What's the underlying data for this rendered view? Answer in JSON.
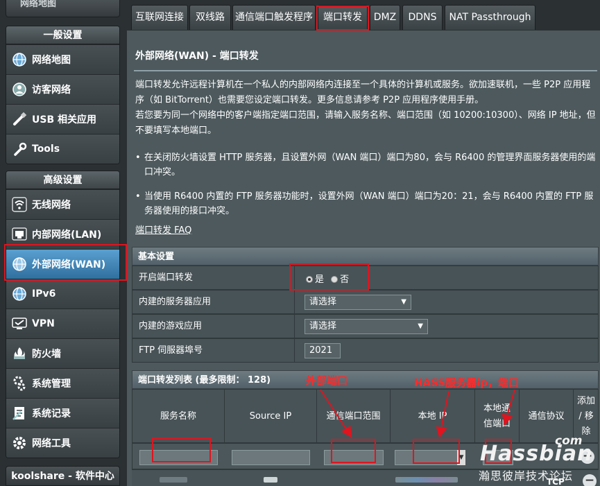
{
  "sidebar": {
    "top_fragment": "网络地图",
    "general": {
      "header": "一般设置",
      "items": [
        {
          "label": "网络地图",
          "icon": "globe-icon"
        },
        {
          "label": "访客网络",
          "icon": "guest-network-icon"
        },
        {
          "label": "USB 相关应用",
          "icon": "usb-icon"
        },
        {
          "label": "Tools",
          "icon": "wrench-icon"
        }
      ]
    },
    "advanced": {
      "header": "高级设置",
      "items": [
        {
          "label": "无线网络",
          "icon": "wifi-icon"
        },
        {
          "label": "内部网络(LAN)",
          "icon": "lan-icon"
        },
        {
          "label": "外部网络(WAN)",
          "icon": "wan-globe-icon",
          "active": true
        },
        {
          "label": "IPv6",
          "icon": "ipv6-globe-icon"
        },
        {
          "label": "VPN",
          "icon": "vpn-icon"
        },
        {
          "label": "防火墙",
          "icon": "firewall-icon"
        },
        {
          "label": "系统管理",
          "icon": "gear-icon"
        },
        {
          "label": "系统记录",
          "icon": "log-icon"
        },
        {
          "label": "网络工具",
          "icon": "tools-gear-icon"
        }
      ]
    },
    "bottom": "koolshare - 软件中心"
  },
  "tabs": [
    {
      "label": "互联网连接"
    },
    {
      "label": "双线路"
    },
    {
      "label": "通信端口触发程序"
    },
    {
      "label": "端口转发",
      "active": true
    },
    {
      "label": "DMZ"
    },
    {
      "label": "DDNS"
    },
    {
      "label": "NAT Passthrough"
    }
  ],
  "main": {
    "title": "外部网络(WAN) - 端口转发",
    "desc1": "端口转发允许远程计算机在一个私人的内部网络内连接至一个具体的计算机或服务。欲加速联机，一些 P2P 应用程序（如 BitTorrent）也需要您设定端口转发。更多信息请参考 P2P 应用程序使用手册。",
    "desc2": "若您要为同一个网络中的客户端指定端口范围，请输入服务名称、端口范围（如 10200:10300）、网络 IP 地址，但不要填写本地端口。",
    "bullet1": "在关闭防火墙设置 HTTP 服务器，且设置外网（WAN 端口）端口为80，会与 R6400 的管理界面服务器使用的端口冲突。",
    "bullet2": "当使用 R6400 内置的 FTP 服务器功能时，设置外网（WAN 端口）端口为20：21，会与 R6400 内置的 FTP 服务器使用的接口冲突。",
    "faq": "端口转发 FAQ"
  },
  "basic": {
    "header": "基本设置",
    "enable_label": "开启端口转发",
    "yes": "是",
    "no": "否",
    "server_app_label": "内建的服务器应用",
    "server_app_value": "请选择",
    "game_app_label": "内建的游戏应用",
    "game_app_value": "请选择",
    "ftp_label": "FTP 伺服器埠号",
    "ftp_value": "2021"
  },
  "table": {
    "header": "端口转发列表 (最多限制： 128)",
    "cols": [
      "服务名称",
      "Source IP",
      "通信端口范围",
      "本地 IP",
      "本地通信端口",
      "通信协议",
      "添加 / 移除"
    ],
    "proto_partial": "TCP"
  },
  "annotations": {
    "external_port": "外部端口",
    "hass_ip": "HASS服务器ip，端口"
  },
  "watermark": {
    "brand": "Hassbian",
    "com": "com",
    "sub": "瀚思彼岸技术论坛"
  }
}
